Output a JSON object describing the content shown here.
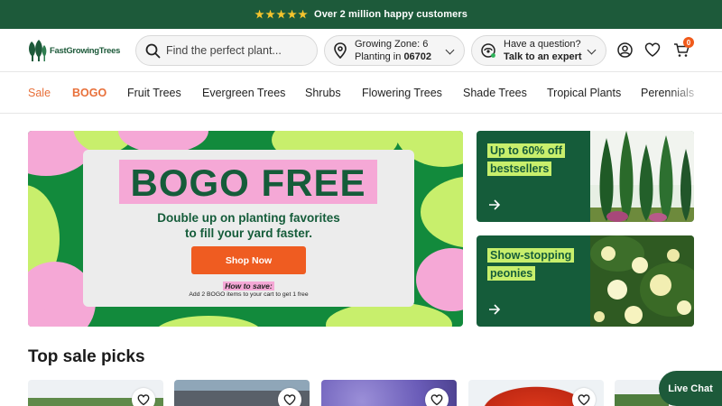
{
  "announcement": {
    "text": "Over 2 million happy customers",
    "stars": 5,
    "star_color": "#f6c52d",
    "bg_color": "#1d5a3a"
  },
  "header": {
    "logo_text": "FastGrowingTrees",
    "search": {
      "placeholder": "Find the perfect plant..."
    },
    "zone": {
      "line1": "Growing Zone: 6",
      "line2_prefix": "Planting in",
      "zip": "06702"
    },
    "expert": {
      "line1": "Have a question?",
      "line2": "Talk to an expert"
    },
    "icons": [
      "search-icon",
      "location-pin-icon",
      "expert-headset-icon",
      "account-icon",
      "heart-icon",
      "cart-icon"
    ],
    "cart_count": "0"
  },
  "nav": {
    "items": [
      "Sale",
      "BOGO",
      "Fruit Trees",
      "Evergreen Trees",
      "Shrubs",
      "Flowering Trees",
      "Shade Trees",
      "Tropical Plants",
      "Perennials"
    ],
    "accent_color": "#e8703a"
  },
  "hero": {
    "title": "BOGO FREE",
    "subtitle_line1": "Double up on planting favorites",
    "subtitle_line2": "to fill your yard faster.",
    "button": "Shop Now",
    "how_to_save": "How to save:",
    "how_to_text": "Add 2 BOGO items to your cart to get 1 free",
    "button_color": "#ef5c21"
  },
  "promos": [
    {
      "line1": "Up to 60% off",
      "line2": "bestsellers"
    },
    {
      "line1": "Show-stopping",
      "line2": "peonies"
    }
  ],
  "section": {
    "title": "Top sale picks"
  },
  "live_chat": {
    "label": "Live Chat"
  },
  "colors": {
    "brand_green": "#1d5a3a",
    "lime": "#c8ef6c",
    "pink": "#f5a8d6"
  }
}
